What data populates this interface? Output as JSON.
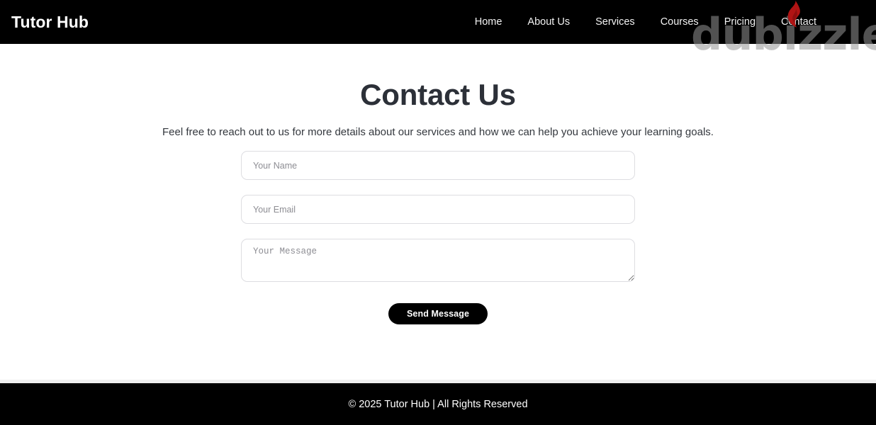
{
  "header": {
    "brand": "Tutor Hub",
    "nav": [
      {
        "label": "Home"
      },
      {
        "label": "About Us"
      },
      {
        "label": "Services"
      },
      {
        "label": "Courses"
      },
      {
        "label": "Pricing"
      },
      {
        "label": "Contact"
      }
    ]
  },
  "watermark": {
    "text": "dubizzle",
    "icon": "flame-icon",
    "icon_color": "#b01414",
    "text_color": "#969696"
  },
  "main": {
    "title": "Contact Us",
    "subtitle": "Feel free to reach out to us for more details about our services and how we can help you achieve your learning goals.",
    "form": {
      "name_value": "",
      "name_placeholder": "Your Name",
      "email_value": "",
      "email_placeholder": "Your Email",
      "message_value": "",
      "message_placeholder": "Your Message",
      "submit_label": "Send Message"
    }
  },
  "footer": {
    "text": "© 2025 Tutor Hub | All Rights Reserved"
  },
  "colors": {
    "header_bg": "#000000",
    "page_bg": "#ffffff",
    "title": "#2c3038",
    "accent": "#000000",
    "input_border": "#dddde1",
    "placeholder": "#8d8d93"
  }
}
